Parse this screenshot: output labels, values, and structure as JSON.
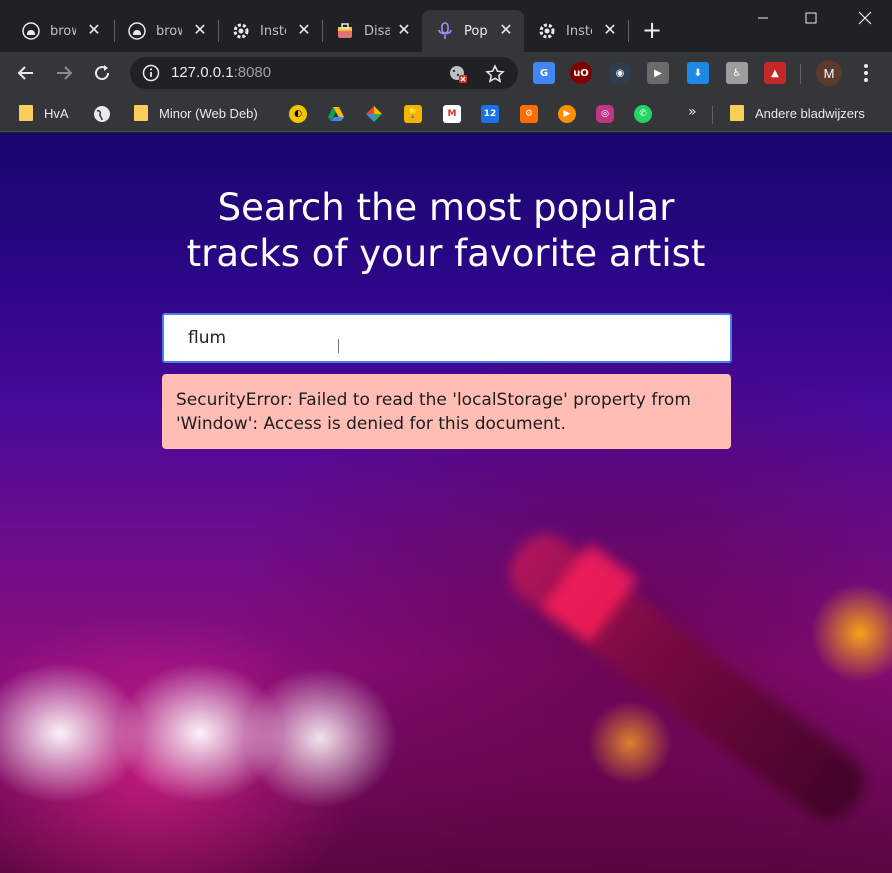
{
  "tabs": [
    {
      "title": "brow",
      "icon": "github-icon"
    },
    {
      "title": "brow",
      "icon": "github-icon"
    },
    {
      "title": "Inste",
      "icon": "gear-icon"
    },
    {
      "title": "Disa",
      "icon": "briefcase-icon"
    },
    {
      "title": "Pop",
      "icon": "microphone-icon",
      "active": true
    },
    {
      "title": "Inste",
      "icon": "gear-icon"
    }
  ],
  "address": {
    "host": "127.0.0.1",
    "port": ":8080"
  },
  "profile_initial": "M",
  "bookmarks": {
    "hva": "HvA",
    "minor": "Minor (Web Deb)",
    "more": "»",
    "other": "Andere bladwijzers",
    "calendar_day": "12"
  },
  "page": {
    "headline_line1": "Search the most popular",
    "headline_line2": "tracks of your favorite artist",
    "search_value": "flum",
    "error_message": "SecurityError: Failed to read the 'localStorage' property from 'Window': Access is denied for this document."
  },
  "colors": {
    "accent": "#4a7cf0",
    "error_bg": "#ffbdb6",
    "page_top": "#19066e",
    "page_bottom": "#8a0f7c"
  }
}
